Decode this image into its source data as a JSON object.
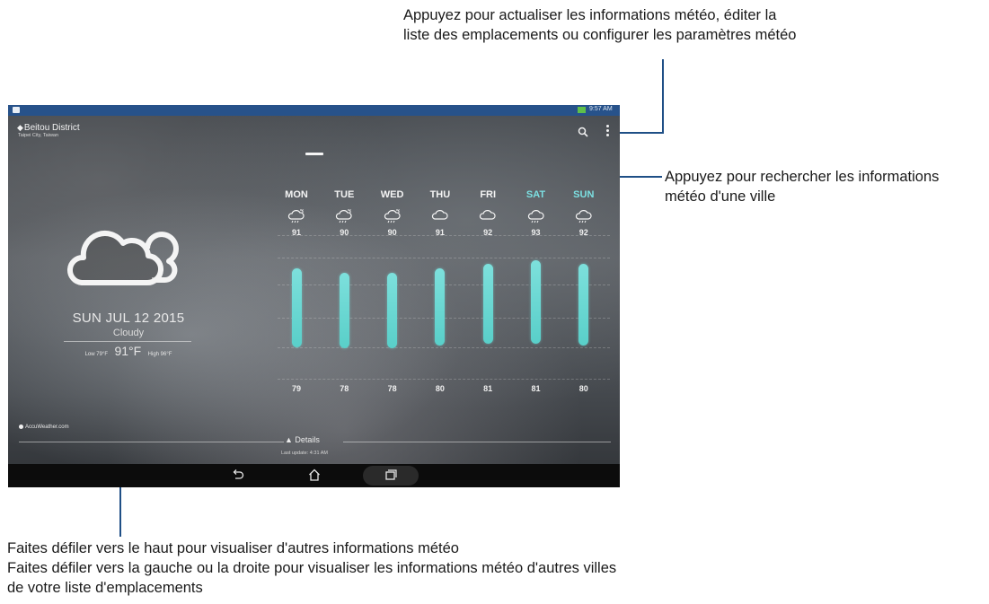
{
  "callouts": {
    "refresh_line1": "Appuyez pour actualiser les informations météo, éditer la",
    "refresh_line2": "liste des emplacements ou configurer les paramètres météo",
    "search_line1": "Appuyez pour rechercher les informations",
    "search_line2": "météo d'une ville",
    "scroll_line1": "Faites défiler vers le haut pour visualiser d'autres informations météo",
    "scroll_line2": "Faites défiler vers la gauche ou la droite pour visualiser les informations météo d'autres villes",
    "scroll_line3": "de votre liste d'emplacements"
  },
  "status_bar": {
    "time": "9:57 AM"
  },
  "location": {
    "name": "Beitou District",
    "subtitle": "Taipei City, Taiwan"
  },
  "current": {
    "date": "SUN JUL 12 2015",
    "condition": "Cloudy",
    "low": "Low 79°F",
    "temp": "91°F",
    "high": "High 96°F",
    "icon": "cloud-icon"
  },
  "forecast": [
    {
      "day": "MON",
      "high": "91",
      "low": "79",
      "icon": "cloud-sun-rain-icon",
      "weekend": false
    },
    {
      "day": "TUE",
      "high": "90",
      "low": "78",
      "icon": "cloud-sun-rain-icon",
      "weekend": false
    },
    {
      "day": "WED",
      "high": "90",
      "low": "78",
      "icon": "cloud-sun-rain-icon",
      "weekend": false
    },
    {
      "day": "THU",
      "high": "91",
      "low": "80",
      "icon": "cloud-icon",
      "weekend": false
    },
    {
      "day": "FRI",
      "high": "92",
      "low": "81",
      "icon": "cloud-icon",
      "weekend": false
    },
    {
      "day": "SAT",
      "high": "93",
      "low": "81",
      "icon": "cloud-rain-icon",
      "weekend": true
    },
    {
      "day": "SUN",
      "high": "92",
      "low": "80",
      "icon": "cloud-rain-icon",
      "weekend": true
    }
  ],
  "footer": {
    "brand": "AccuWeather.com",
    "details": "▲ Details",
    "last_update": "Last update: 4:31 AM"
  },
  "colors": {
    "accent": "#6fd9d4",
    "status_bar": "#27528a",
    "callout_line": "#1f4f86",
    "weekend": "#7ce0e2"
  }
}
